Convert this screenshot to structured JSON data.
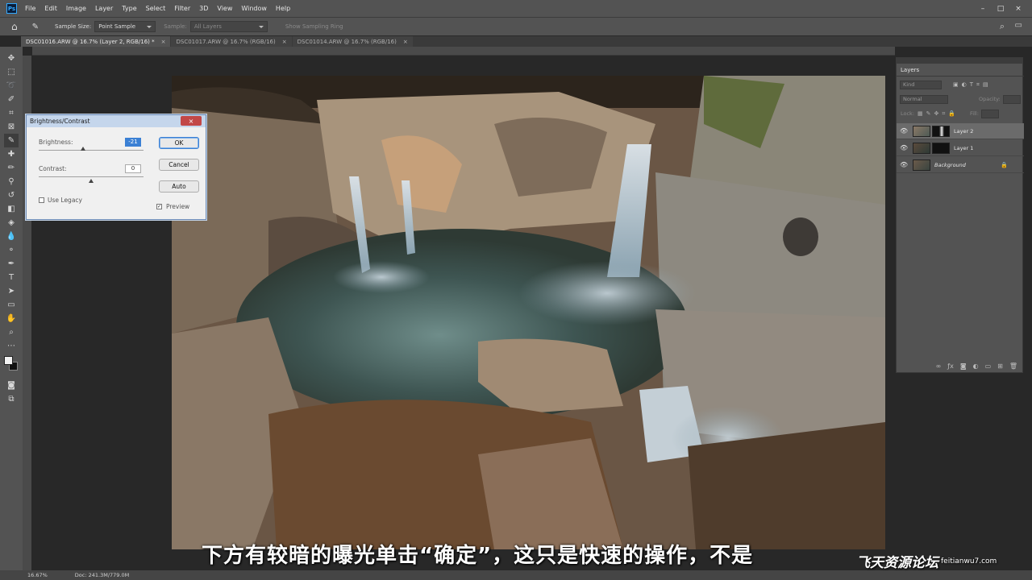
{
  "menu": {
    "logo": "Ps",
    "items": [
      "File",
      "Edit",
      "Image",
      "Layer",
      "Type",
      "Select",
      "Filter",
      "3D",
      "View",
      "Window",
      "Help"
    ],
    "window_controls": [
      "–",
      "□",
      "×"
    ]
  },
  "options": {
    "home_icon": "⌂",
    "sample_size_label": "Sample Size:",
    "sample_size_value": "Point Sample",
    "sample_label": "Sample:",
    "sample_value": "All Layers",
    "show_sampling_ring": "Show Sampling Ring"
  },
  "tabs": [
    {
      "label": "DSC01016.ARW @ 16.7% (Layer 2, RGB/16) *",
      "close": "×"
    },
    {
      "label": "DSC01017.ARW @ 16.7% (RGB/16)",
      "close": "×"
    },
    {
      "label": "DSC01014.ARW @ 16.7% (RGB/16)",
      "close": "×"
    }
  ],
  "dialog": {
    "title": "Brightness/Contrast",
    "close": "×",
    "brightness_label": "Brightness:",
    "brightness_value": "-21",
    "contrast_label": "Contrast:",
    "contrast_value": "0",
    "use_legacy_label": "Use Legacy",
    "preview_label": "Preview",
    "preview_check": "✓",
    "ok": "OK",
    "cancel": "Cancel",
    "auto": "Auto"
  },
  "layers": {
    "tab": "Layers",
    "kind": "Kind",
    "blend_mode": "Normal",
    "opacity": "Opacity:",
    "lock": "Lock:",
    "fill": "Fill:",
    "rows": [
      {
        "name": "Layer 2",
        "eye": "👁",
        "active": true
      },
      {
        "name": "Layer 1",
        "eye": "👁",
        "active": false
      },
      {
        "name": "Background",
        "eye": "👁",
        "active": false,
        "lock": "🔒"
      }
    ]
  },
  "status": {
    "zoom": "16.67%",
    "doc": "Doc: 241.3M/779.0M"
  },
  "subtitle": "下方有较暗的曝光单击“确定”，这只是快速的操作，不是",
  "watermark": {
    "cn": "飞天资源论坛",
    "url": "feitianwu7.com"
  }
}
